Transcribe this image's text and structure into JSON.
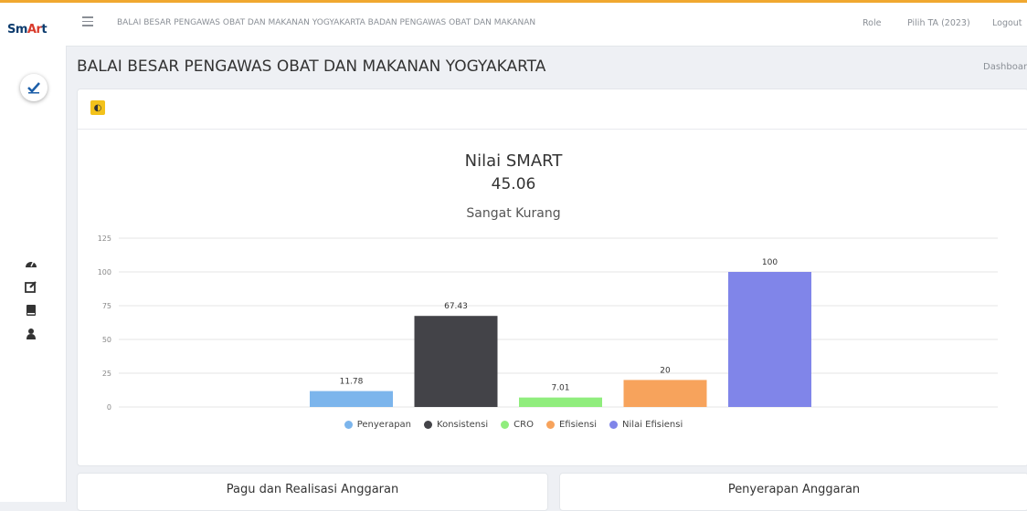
{
  "app": {
    "logo_text_1": "Sm",
    "logo_text_2": "Ar",
    "logo_text_3": "t"
  },
  "topbar": {
    "title": "BALAI BESAR PENGAWAS OBAT DAN MAKANAN YOGYAKARTA BADAN PENGAWAS OBAT DAN MAKANAN",
    "role_label": "Role",
    "year_label": "Pilih TA (2023)",
    "logout_label": "Logout"
  },
  "header": {
    "title": "BALAI BESAR PENGAWAS OBAT DAN MAKANAN YOGYAKARTA",
    "breadcrumb": "Dashboard"
  },
  "sidebar": {
    "icons": [
      "dashboard-icon",
      "edit-icon",
      "book-icon",
      "user-icon"
    ]
  },
  "summary": {
    "title": "Nilai SMART",
    "value": "45.06",
    "category": "Sangat Kurang"
  },
  "colors": {
    "accent": "#f0a830",
    "header_icon": "#f3c21b"
  },
  "chart_data": {
    "type": "bar",
    "categories": [
      "Penyerapan",
      "Konsistensi",
      "CRO",
      "Efisiensi",
      "Nilai Efisiensi"
    ],
    "values": [
      11.78,
      67.43,
      7.01,
      20,
      100
    ],
    "value_labels": [
      "11.78",
      "67.43",
      "7.01",
      "20",
      "100"
    ],
    "colors": [
      "#7cb5ec",
      "#434348",
      "#90ed7d",
      "#f7a35c",
      "#8085e9"
    ],
    "ylim": [
      0,
      125
    ],
    "yticks": [
      "0",
      "25",
      "50",
      "75",
      "100",
      "125"
    ],
    "grid": true,
    "legend": "bottom"
  },
  "panels": {
    "left_title": "Pagu dan Realisasi Anggaran",
    "right_title": "Penyerapan Anggaran"
  }
}
